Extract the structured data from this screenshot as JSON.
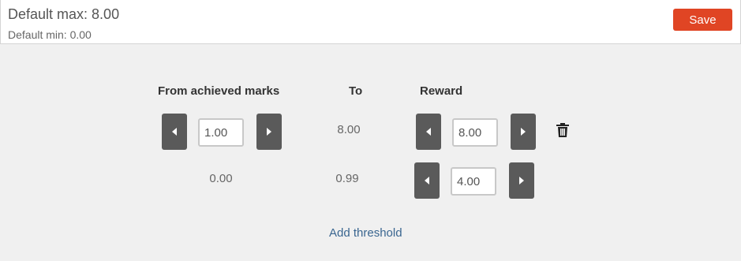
{
  "header": {
    "default_max": "Default max: 8.00",
    "default_min": "Default min: 0.00",
    "save_label": "Save"
  },
  "table": {
    "columns": [
      "From achieved marks",
      "To",
      "Reward"
    ],
    "rows": [
      {
        "from": "1.00",
        "to": "8.00",
        "reward": "8.00"
      },
      {
        "from": "0.00",
        "to": "0.99",
        "reward": "4.00"
      }
    ]
  },
  "add_threshold_label": "Add threshold",
  "colors": {
    "save_button": "#e04524",
    "stepper_button": "#5a5a5a",
    "link": "#3a6690"
  }
}
